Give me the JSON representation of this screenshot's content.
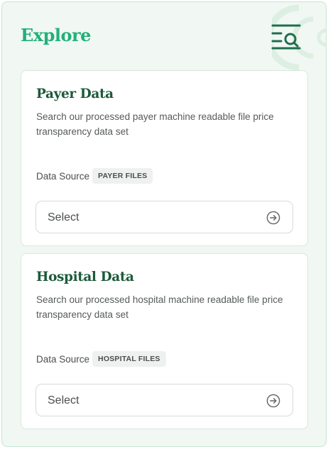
{
  "explore": {
    "title": "Explore",
    "menu_icon": "menu-search-icon"
  },
  "cards": [
    {
      "title": "Payer Data",
      "description": "Search our processed payer machine readable file price transparency data set",
      "source_label": "Data Source",
      "source_badge": "PAYER FILES",
      "select_placeholder": "Select",
      "select_icon": "arrow-circle-right-icon"
    },
    {
      "title": "Hospital Data",
      "description": "Search our processed hospital machine readable file price transparency data set",
      "source_label": "Data Source",
      "source_badge": "HOSPITAL FILES",
      "select_placeholder": "Select",
      "select_icon": "arrow-circle-right-icon"
    }
  ],
  "colors": {
    "panel_bg": "#f1f7f2",
    "panel_border": "#c5e6cf",
    "title_green": "#22b07a",
    "card_title_green": "#1c5a3a",
    "icon_green": "#1f6e4e"
  }
}
